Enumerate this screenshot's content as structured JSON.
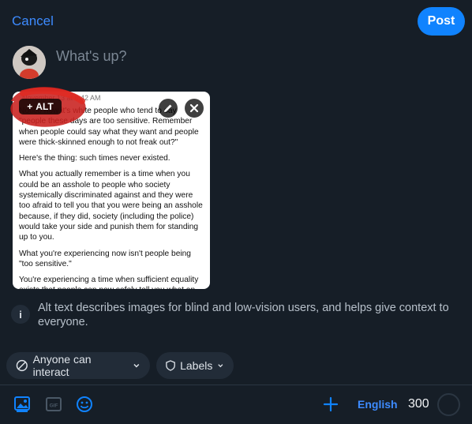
{
  "header": {
    "cancel_label": "Cancel",
    "post_label": "Post"
  },
  "composer": {
    "placeholder": "What's up?"
  },
  "image": {
    "alt_label": "ALT",
    "header_text": "November 13 at 6:42 AM",
    "paragraphs": [
      "Notice how it's white people who tend to say \"people these days are too sensitive. Remember when people could say what they want and people were thick-skinned enough to not freak out?\"",
      "Here's the thing: such times never existed.",
      "What you actually remember is a time when you could be an asshole to people who society systemically discriminated against and they were too afraid to tell you that you were being an asshole because, if they did, society (including the police) would take your side and punish them for standing up to you.",
      "What you're experiencing now isn't people being \"too sensitive.\"",
      "You're experiencing a time when sufficient equality exists that people can now safely tell you what an"
    ]
  },
  "alt_info": {
    "text": "Alt text describes images for blind and low-vision users, and helps give context to everyone."
  },
  "pills": {
    "interaction": "Anyone can interact",
    "labels": "Labels"
  },
  "toolbar": {
    "language": "English",
    "char_count": "300",
    "char_progress": 0
  },
  "colors": {
    "accent": "#1083fe",
    "link": "#3d8bff",
    "background": "#161e27",
    "pill_bg": "#222c38"
  }
}
